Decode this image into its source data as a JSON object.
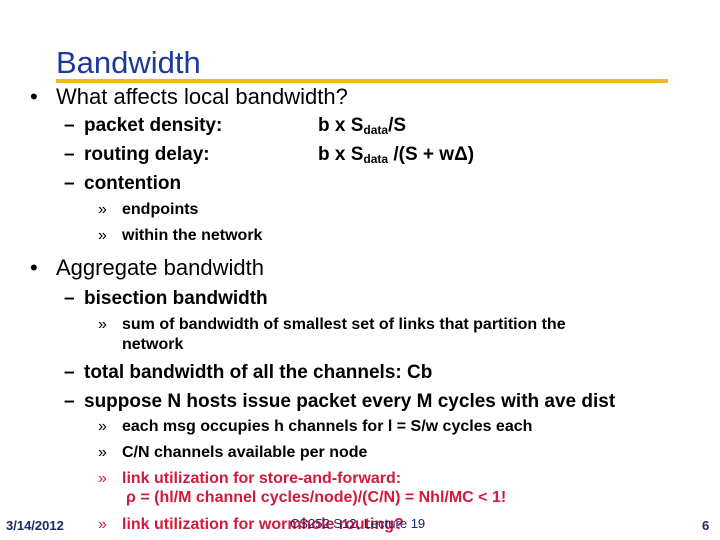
{
  "slide": {
    "title": "Bandwidth",
    "bullets": [
      {
        "text": "What affects local bandwidth?"
      },
      {
        "text": "Aggregate bandwidth"
      }
    ],
    "local": {
      "items": [
        {
          "label": "packet density:",
          "formula_pre": "b x S",
          "formula_sub": "data",
          "formula_post": "/S"
        },
        {
          "label": "routing delay:",
          "formula_pre": "b x S",
          "formula_sub": "data",
          "formula_post": " /(S + wΔ)"
        },
        {
          "label": "contention"
        }
      ],
      "contention_sub": [
        "endpoints",
        "within the network"
      ]
    },
    "aggregate": {
      "bisection": "bisection bandwidth",
      "bisection_sub": [
        "sum of bandwidth of smallest set of links that partition the",
        "network"
      ],
      "total": "total bandwidth of all the channels: Cb",
      "suppose": "suppose N hosts issue packet every M cycles with ave dist",
      "suppose_sub": [
        "each msg occupies h channels for l = S/w cycles each",
        "C/N channels available per node",
        "link utilization for store-and-forward:",
        "ρ = (hl/M channel cycles/node)/(C/N) = Nhl/MC < 1!",
        "link utilization for wormhole routing?"
      ]
    },
    "glyphs": {
      "bullet": "•",
      "dash": "–",
      "raquo": "»"
    },
    "colors": {
      "title": "#1a3a9c",
      "rule": "#f0b823",
      "highlight": "#d21a3c",
      "footer": "#1a2a6c"
    }
  },
  "footer": {
    "date": "3/14/2012",
    "course": "CS252 S12, Lecture 19",
    "page": "6"
  }
}
